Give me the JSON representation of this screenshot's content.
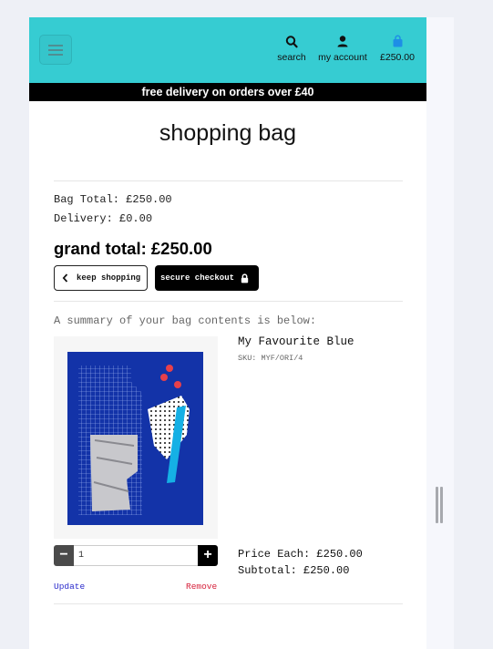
{
  "header": {
    "nav": {
      "search_label": "search",
      "account_label": "my account",
      "bag_total": "£250.00"
    },
    "banner": "free delivery on orders over £40"
  },
  "page": {
    "title": "shopping bag"
  },
  "totals": {
    "bag_total": "Bag Total: £250.00",
    "delivery": "Delivery: £0.00",
    "grand_total": "grand total: £250.00"
  },
  "actions": {
    "keep_shopping": "keep shopping",
    "secure_checkout": "secure checkout"
  },
  "bag": {
    "summary": "A summary of your bag contents is below:",
    "items": [
      {
        "name": "My Favourite Blue",
        "sku": "SKU: MYF/ORI/4",
        "quantity": "1",
        "update_label": "Update",
        "remove_label": "Remove",
        "price_each": "Price Each: £250.00",
        "subtotal": "Subtotal: £250.00"
      }
    ]
  },
  "colors": {
    "header_bg": "#36ccd2",
    "banner_bg": "#000000",
    "bag_icon": "#1e8ee6",
    "update_link": "#2a2acb",
    "remove_link": "#d6203a"
  },
  "icons": [
    "menu-icon",
    "search-icon",
    "user-icon",
    "shopping-bag-icon",
    "chevron-left-icon",
    "lock-icon",
    "minus-icon",
    "plus-icon"
  ]
}
